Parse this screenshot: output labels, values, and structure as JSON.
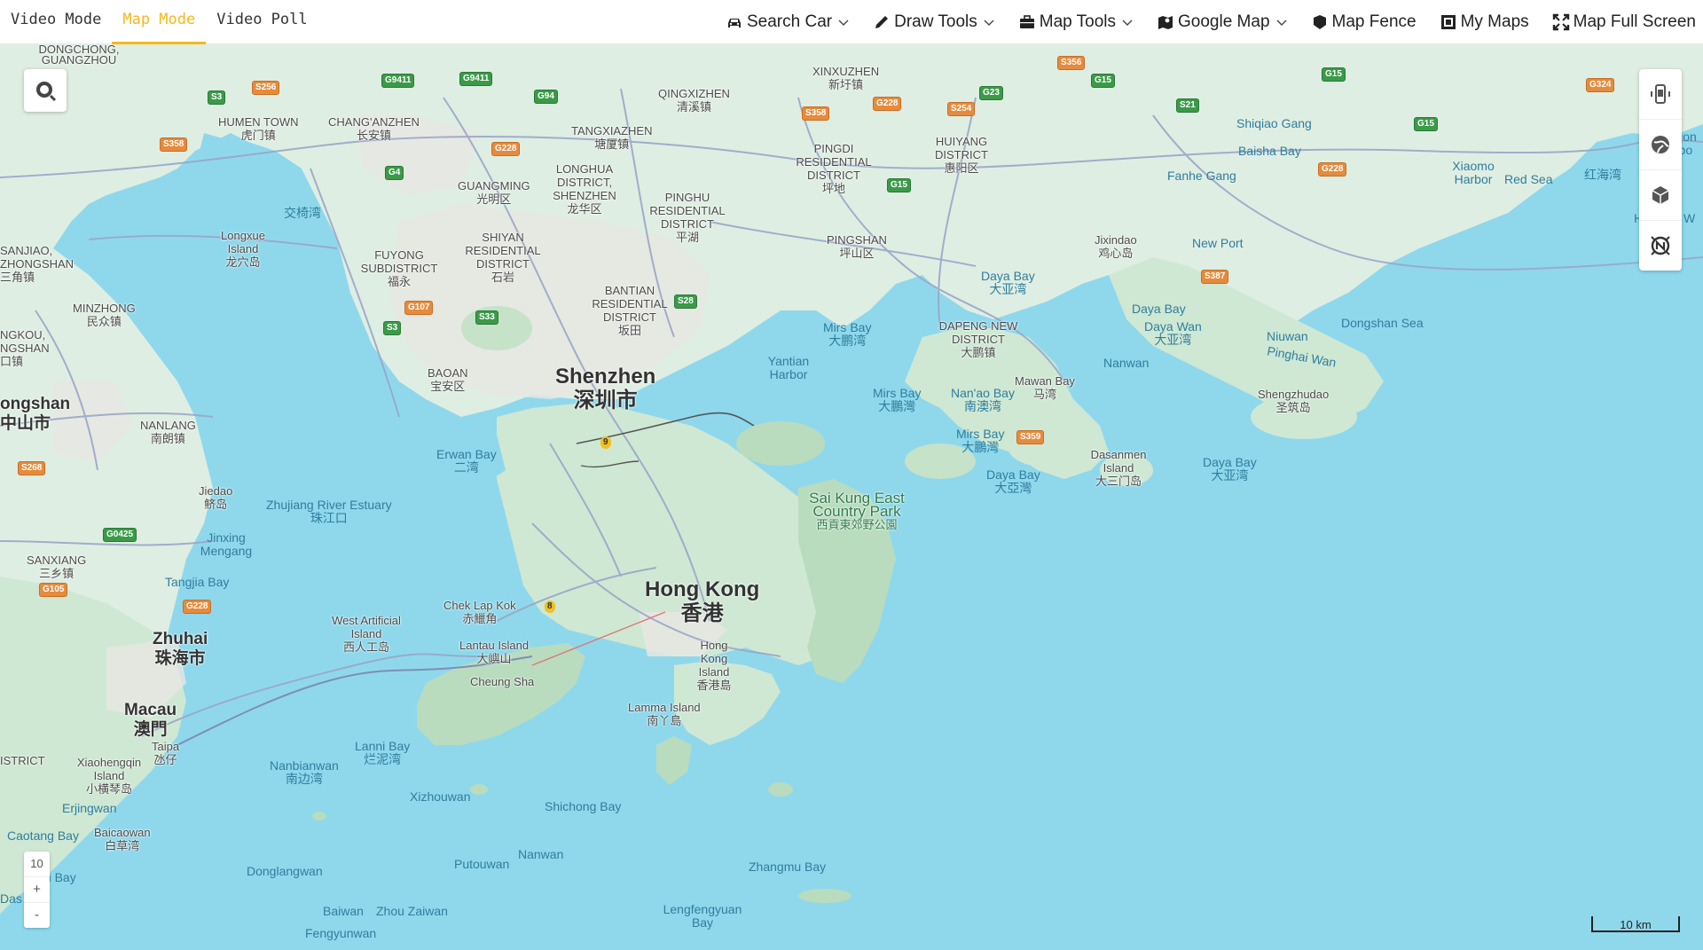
{
  "tabs": [
    {
      "label": "Video Mode"
    },
    {
      "label": "Map Mode"
    },
    {
      "label": "Video Poll"
    }
  ],
  "active_tab": "Map Mode",
  "tools": [
    {
      "label": "Search Car",
      "icon": "car-icon",
      "dropdown": true
    },
    {
      "label": "Draw Tools",
      "icon": "pencil-icon",
      "dropdown": true
    },
    {
      "label": "Map Tools",
      "icon": "toolbox-icon",
      "dropdown": true
    },
    {
      "label": "Google Map",
      "icon": "map-icon",
      "dropdown": true
    },
    {
      "label": "Map Fence",
      "icon": "fence-icon",
      "dropdown": false
    },
    {
      "label": "My Maps",
      "icon": "my-maps-icon",
      "dropdown": false
    },
    {
      "label": "Map Full Screen",
      "icon": "fullscreen-icon",
      "dropdown": false
    }
  ],
  "map": {
    "zoom_level": "10",
    "zoom_in": "+",
    "zoom_out": "-",
    "scale": "10 km",
    "labels": {
      "shenzhen_en": "Shenzhen",
      "shenzhen_zh": "深圳市",
      "hongkong_en": "Hong Kong",
      "hongkong_zh": "香港",
      "zhuhai_en": "Zhuhai",
      "zhuhai_zh": "珠海市",
      "macau_en": "Macau",
      "macau_zh": "澳門",
      "zhongshan": "ongshan",
      "zhongshan_zh": "中山市",
      "dongchong": "DONGCHONG, GUANGZHOU",
      "humen": "HUMEN TOWN",
      "humen_zh": "虎门镇",
      "changanzhen": "CHANG'ANZHEN",
      "changanzhen_zh": "长安镇",
      "qingxizhen": "QINGXIZHEN",
      "qingxizhen_zh": "清溪镇",
      "xinxuzhen": "XINXUZHEN",
      "xinxuzhen_zh": "新圩镇",
      "tangxiazhen": "TANGXIAZHEN",
      "tangxiazhen_zh": "塘厦镇",
      "pingdi": "PINGDI RESIDENTIAL DISTRICT",
      "pingdi_zh": "坪地",
      "huiyang": "HUIYANG DISTRICT",
      "huiyang_zh": "惠阳区",
      "longhua": "LONGHUA DISTRICT, SHENZHEN",
      "longhua_zh": "龙华区",
      "guangming": "GUANGMING",
      "guangming_zh": "光明区",
      "pinghu": "PINGHU RESIDENTIAL DISTRICT",
      "pinghu_zh": "平湖",
      "pingshan": "PINGSHAN",
      "pingshan_zh": "坪山区",
      "shiyan": "SHIYAN RESIDENTIAL DISTRICT",
      "shiyan_zh": "石岩",
      "bantian": "BANTIAN RESIDENTIAL DISTRICT",
      "bantian_zh": "坂田",
      "fuyong": "FUYONG SUBDISTRICT",
      "fuyong_zh": "福永",
      "baoan": "BAOAN",
      "baoan_zh": "宝安区",
      "dapeng": "DAPENG NEW DISTRICT",
      "dapeng_zh": "大鹏镇",
      "sanjiao": "SANJIAO, ZHONGSHAN",
      "sanjiao_zh": "三角镇",
      "minzhong": "MINZHONG",
      "minzhong_zh": "民众镇",
      "nangkou": "NGKOU, NGSHAN",
      "nangkou_zh": "口镇",
      "nanlang": "NANLANG",
      "nanlang_zh": "南朗镇",
      "sanxiang": "SANXIANG",
      "sanxiang_zh": "三乡镇",
      "longxue": "Longxue Island",
      "longxue_zh": "龙穴岛",
      "jiaoyimen": "交椅湾",
      "jiedao": "Jiedao",
      "jiedao_zh": "鲚岛",
      "jinxing": "Jinxing Mengang",
      "tangjia": "Tangjia Bay",
      "zhujiang": "Zhujiang River Estuary",
      "zhujiang_zh": "珠江口",
      "westisland": "West Artificial Island",
      "westisland_zh": "西人工岛",
      "cheklapkok": "Chek Lap Kok",
      "cheklapkok_zh": "赤鱲角",
      "lantau": "Lantau Island",
      "lantau_zh": "大嶼山",
      "cheungsha": "Cheung Sha",
      "hkisland": "Hong Kong Island",
      "hkisland_zh": "香港島",
      "lamma": "Lamma Island",
      "lamma_zh": "南丫島",
      "saikung": "Sai Kung East Country Park",
      "saikung_zh": "西貢東郊野公園",
      "erwan": "Erwan Bay",
      "erwan_zh": "二湾",
      "yantian": "Yantian Harbor",
      "mirsbay1": "Mirs Bay",
      "mirsbay1_zh": "大鹏湾",
      "mirsbay2": "Mirs Bay",
      "mirsbay2_zh": "大鵬灣",
      "mirsbay3": "Mirs Bay",
      "mirsbay3_zh": "大鵬灣",
      "nanaobay": "Nan'ao Bay",
      "nanaobay_zh": "南澳湾",
      "dayabay1": "Daya Bay",
      "dayabay1_zh": "大亚湾",
      "dayabay2": "Daya Bay",
      "dayabay2_zh": "大亞灣",
      "dayabay3": "Daya Bay",
      "dayabay3_zh": "大亚湾",
      "dayabay4": "Daya Bay",
      "dayawan": "Daya Wan",
      "dayawan_zh": "大亚湾",
      "mawanbay": "Mawan Bay",
      "mawanbay_zh": "马湾",
      "nanwan1": "Nanwan",
      "nanwan2": "Nanwan",
      "jixindao": "Jixindao",
      "jixindao_zh": "鸡心岛",
      "newport": "New Port",
      "dasanmen": "Dasanmen Island",
      "dasanmen_zh": "大三门岛",
      "niuwan": "Niuwan",
      "pinghaiwan": "Pinghai Wan",
      "dongshansea": "Dongshan Sea",
      "shengzhudao": "Shengzhudao",
      "shengzhudao_zh": "圣筑岛",
      "shiqiaogang": "Shiqiao Gang",
      "baishabay": "Baisha Bay",
      "fanhegang": "Fanhe Gang",
      "xiaomo": "Xiaomo Harbor",
      "redsea": "Red Sea",
      "redsea_zh": "红海湾",
      "magonharbor": "Magon Harbo",
      "honghai": "Honghai W",
      "taipa": "Taipa",
      "taipa_zh": "氹仔",
      "xiaohengqin": "Xiaohengqin Island",
      "xiaohengqin_zh": "小横琴岛",
      "erjingwan": "Erjingwan",
      "caotang": "Caotang Bay",
      "baicaowan": "Baicaowan",
      "baicaowan_zh": "白草湾",
      "nanbianwan": "Nanbianwan",
      "nanbianwan_zh": "南边湾",
      "lannibay": "Lanni Bay",
      "lannibay_zh": "烂泥湾",
      "xizhouwan": "Xizhouwan",
      "shichongbay": "Shichong Bay",
      "putouwan": "Putouwan",
      "nanwan3": "Nanwan",
      "donglangwan": "Donglangwan",
      "zhangmubay": "Zhangmu Bay",
      "lengfengyuan": "Lengfengyuan Bay",
      "baiwan": "Baiwan",
      "zhouzaiwan": "Zhou Zaiwan",
      "fengyunwan": "Fengyunwan",
      "district": "ISTRICT",
      "jianbay": "Jian Bay",
      "das": "Das"
    },
    "shields": [
      "S256",
      "G9411",
      "G9411",
      "G94",
      "S3",
      "S358",
      "G228",
      "G4",
      "S358",
      "G228",
      "S254",
      "G23",
      "G15",
      "S356",
      "G15",
      "S21",
      "G15",
      "G324",
      "G228",
      "G15",
      "G107",
      "S33",
      "S28",
      "S3",
      "S387",
      "S359",
      "S268",
      "G0425",
      "G105",
      "G228",
      "9",
      "8"
    ]
  }
}
